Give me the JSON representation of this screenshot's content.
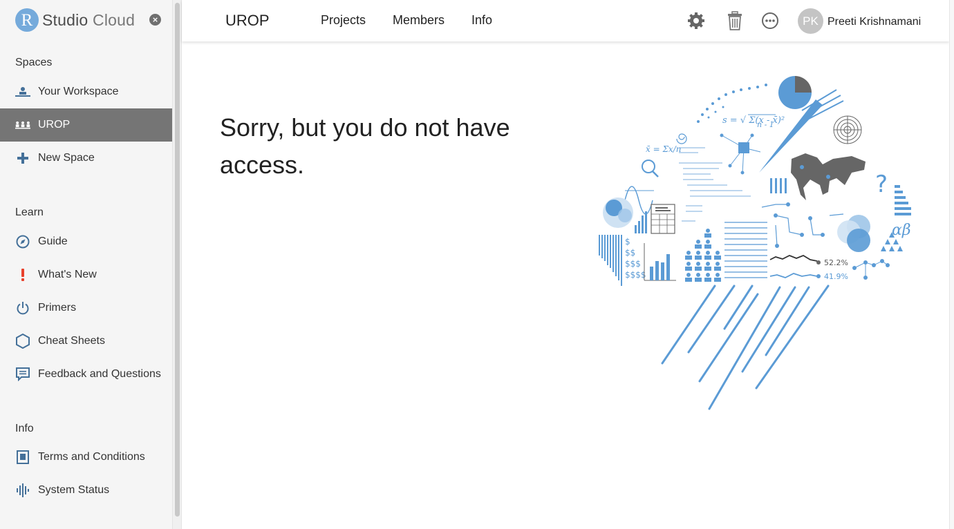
{
  "brand": {
    "logo_letter": "R",
    "name_part1": "Studio",
    "name_part2": " Cloud"
  },
  "sidebar": {
    "sections": {
      "spaces": "Spaces",
      "learn": "Learn",
      "info": "Info"
    },
    "spaces_items": [
      {
        "label": "Your Workspace",
        "icon": "workspace-icon",
        "active": false
      },
      {
        "label": "UROP",
        "icon": "people-icon",
        "active": true
      },
      {
        "label": "New Space",
        "icon": "plus-icon",
        "active": false
      }
    ],
    "learn_items": [
      {
        "label": "Guide",
        "icon": "compass-icon"
      },
      {
        "label": "What's New",
        "icon": "exclamation-icon"
      },
      {
        "label": "Primers",
        "icon": "power-icon"
      },
      {
        "label": "Cheat Sheets",
        "icon": "hexagon-icon"
      },
      {
        "label": "Feedback and Questions",
        "icon": "chat-icon"
      }
    ],
    "info_items": [
      {
        "label": "Terms and Conditions",
        "icon": "document-icon"
      },
      {
        "label": "System Status",
        "icon": "pulse-icon"
      }
    ]
  },
  "header": {
    "space_title": "UROP",
    "tabs": [
      "Projects",
      "Members",
      "Info"
    ],
    "user": {
      "initials": "PK",
      "name": "Preeti Krishnamani"
    }
  },
  "main": {
    "message": "Sorry, but you do not have access.",
    "illustration_labels": {
      "pct1": "52.2%",
      "pct2": "41.9%",
      "greek": "αβ"
    }
  },
  "colors": {
    "accent": "#75aadb",
    "sidebar_bg": "#f5f5f5",
    "active_item_bg": "#757575",
    "icon_blue": "#447099",
    "alert_red": "#e8412c",
    "illustration_blue": "#5b9bd5",
    "illustration_gray": "#666666"
  }
}
